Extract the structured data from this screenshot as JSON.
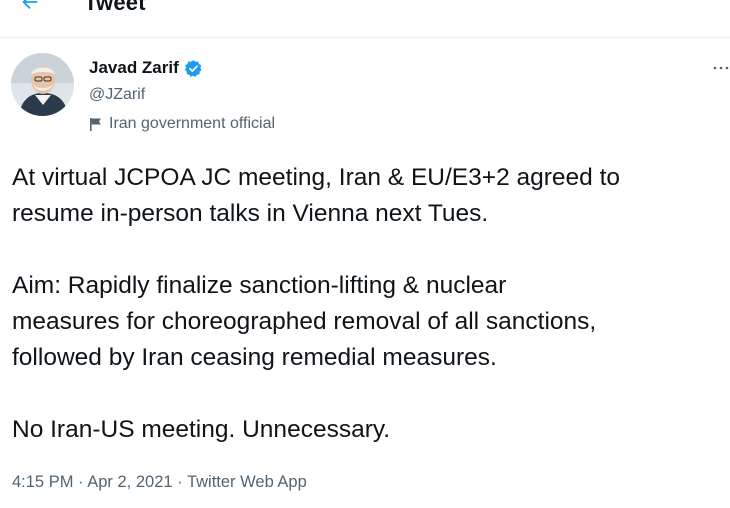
{
  "header": {
    "back_icon": "left-arrow-icon",
    "title": "Tweet"
  },
  "author": {
    "display_name": "Javad Zarif",
    "verified_icon": "verified-badge-icon",
    "handle": "@JZarif",
    "label_icon": "flag-icon",
    "label": "Iran government official"
  },
  "more_icon": "more-options-icon",
  "tweet": {
    "paragraphs": [
      "At virtual JCPOA JC meeting, Iran & EU/E3+2 agreed to\nresume in-person talks in Vienna next Tues.",
      "Aim: Rapidly finalize sanction-lifting & nuclear\nmeasures for choreographed removal of all sanctions,\nfollowed by Iran ceasing remedial measures.",
      "No Iran-US meeting. Unnecessary."
    ]
  },
  "meta": {
    "time": "4:15 PM",
    "separator": "·",
    "date": "Apr 2, 2021",
    "source": "Twitter Web App"
  },
  "colors": {
    "accent": "#1d9bf0",
    "secondary_text": "#536471",
    "primary_text": "#0f1419"
  }
}
